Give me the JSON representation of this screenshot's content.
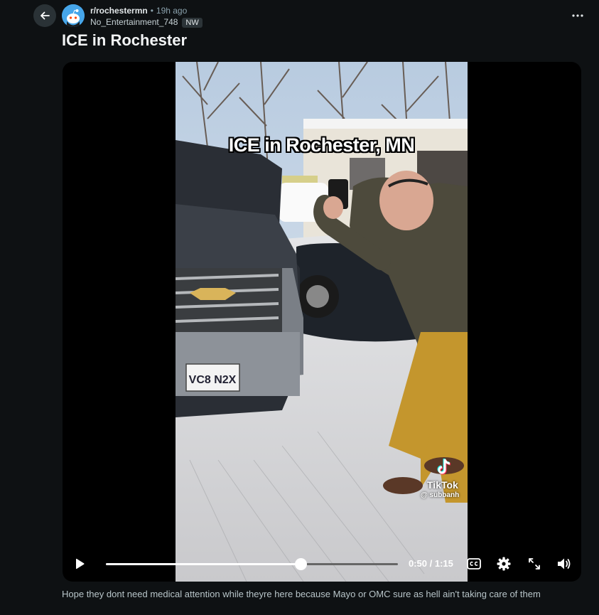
{
  "post": {
    "subreddit": "r/rochestermn",
    "separator": "•",
    "time_ago": "19h ago",
    "author": "No_Entertainment_748",
    "flair": "NW",
    "title": "ICE in Rochester",
    "body": "Hope they dont need medical attention while theyre here because Mayo or OMC sure as hell ain't taking care of them"
  },
  "video": {
    "overlay_text": "ICE in Rochester, MN",
    "watermark_brand": "TikTok",
    "watermark_user": "@ subbanh",
    "license_plate": "VC8 N2X",
    "current_time": "0:50",
    "duration": "1:15",
    "time_readout": "0:50 / 1:15",
    "progress": 0.6667
  },
  "icons": {
    "back": "arrow-left-icon",
    "more": "more-horizontal-icon",
    "play": "play-icon",
    "captions": "closed-captions-icon",
    "settings": "gear-icon",
    "expand": "expand-icon",
    "volume": "volume-icon"
  },
  "colors": {
    "background": "#0e1113",
    "player_bg": "#000000",
    "progress_fill": "#ffffff",
    "progress_track": "#666666",
    "avatar_blue": "#46a6ea"
  }
}
